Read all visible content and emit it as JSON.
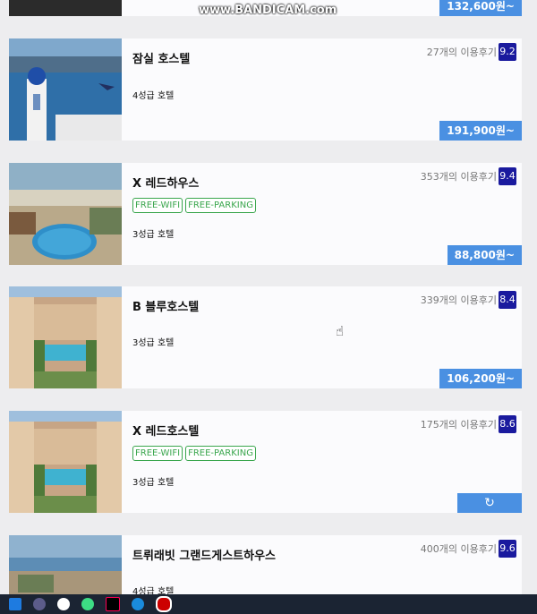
{
  "watermark": "www.BANDICAM.com",
  "top_card": {
    "price": "132,600원~"
  },
  "hotels": [
    {
      "name": "잠실 호스텔",
      "reviews": "27개의 이용후기",
      "score": "9.2",
      "grade": "4성급 호텔",
      "tags": [],
      "price": "191,900원~"
    },
    {
      "name": "X 레드하우스",
      "reviews": "353개의 이용후기",
      "score": "9.4",
      "grade": "3성급 호텔",
      "tags": [
        "FREE-WIFI",
        "FREE-PARKING"
      ],
      "price": "88,800원~"
    },
    {
      "name": "B 블루호스텔",
      "reviews": "339개의 이용후기",
      "score": "8.4",
      "grade": "3성급 호텔",
      "tags": [],
      "price": "106,200원~"
    },
    {
      "name": "X 레드호스텔",
      "reviews": "175개의 이용후기",
      "score": "8.6",
      "grade": "3성급 호텔",
      "tags": [
        "FREE-WIFI",
        "FREE-PARKING"
      ],
      "price_icon": "refresh-icon"
    },
    {
      "name": "트뤼래빗 그랜드게스트하우스",
      "reviews": "400개의 이용후기",
      "score": "9.6",
      "grade": "4성급 호텔",
      "tags": []
    }
  ],
  "colors": {
    "price_bg": "#4a90e2",
    "score_bg": "#1a1a9e",
    "tag": "#3aa64d"
  }
}
